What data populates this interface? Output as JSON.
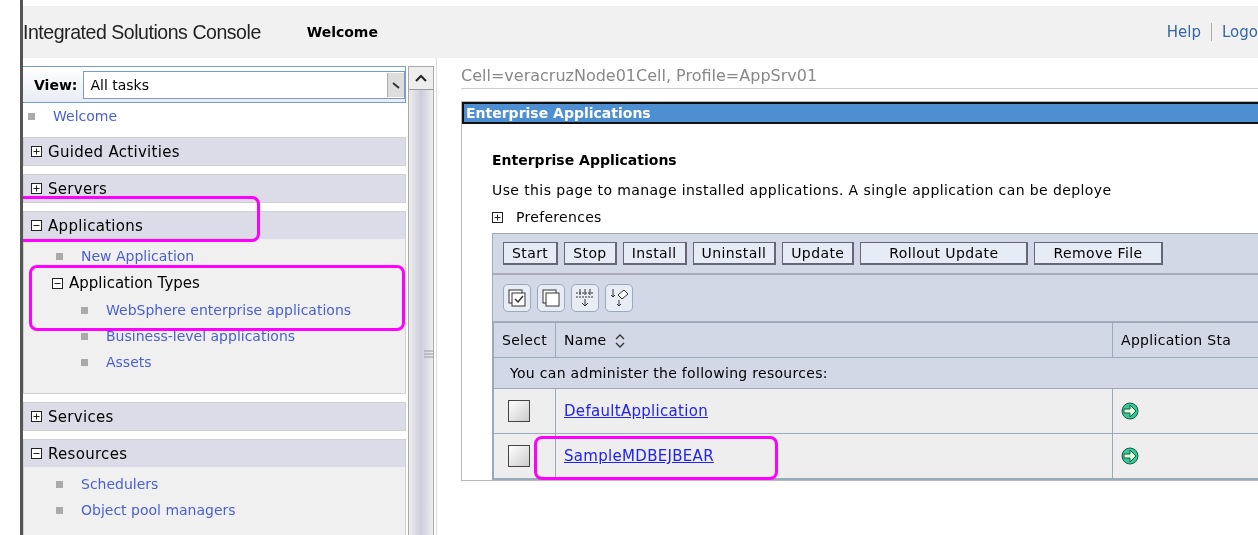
{
  "header": {
    "title": "Integrated Solutions Console",
    "welcome": "Welcome",
    "links": [
      "Help",
      "Logo"
    ]
  },
  "nav": {
    "view_label": "View:",
    "view_value": "All tasks",
    "items": [
      {
        "kind": "link",
        "label": "Welcome"
      },
      {
        "kind": "section",
        "label": "Guided Activities",
        "expanded": false,
        "highlighted": false
      },
      {
        "kind": "section",
        "label": "Servers",
        "expanded": false,
        "highlighted": false
      },
      {
        "kind": "section",
        "label": "Applications",
        "expanded": true,
        "highlighted": true,
        "children": [
          {
            "kind": "link",
            "label": "New Application"
          },
          {
            "kind": "group",
            "label": "Application Types",
            "expanded": true,
            "highlighted": true,
            "children": [
              {
                "kind": "link",
                "label": "WebSphere enterprise applications"
              },
              {
                "kind": "link",
                "label": "Business-level applications"
              },
              {
                "kind": "link",
                "label": "Assets"
              }
            ]
          }
        ]
      },
      {
        "kind": "section",
        "label": "Services",
        "expanded": false,
        "highlighted": false
      },
      {
        "kind": "section",
        "label": "Resources",
        "expanded": true,
        "highlighted": false,
        "children": [
          {
            "kind": "link",
            "label": "Schedulers"
          },
          {
            "kind": "link",
            "label": "Object pool managers"
          }
        ]
      }
    ]
  },
  "breadcrumb": "Cell=veracruzNode01Cell, Profile=AppSrv01",
  "panel": {
    "title": "Enterprise Applications",
    "heading": "Enterprise Applications",
    "description": "Use this page to manage installed applications. A single application can be deploye",
    "preferences": {
      "label": "Preferences",
      "expanded": false
    },
    "buttons": [
      "Start",
      "Stop",
      "Install",
      "Uninstall",
      "Update",
      "Rollout Update",
      "Remove File"
    ],
    "table": {
      "columns": [
        "Select",
        "Name",
        "Application Sta"
      ],
      "note": "You can administer the following resources:",
      "rows": [
        {
          "name": "DefaultApplication",
          "checked": false,
          "highlighted": false
        },
        {
          "name": "SampleMDBEJBEAR",
          "checked": false,
          "highlighted": true
        }
      ]
    }
  }
}
